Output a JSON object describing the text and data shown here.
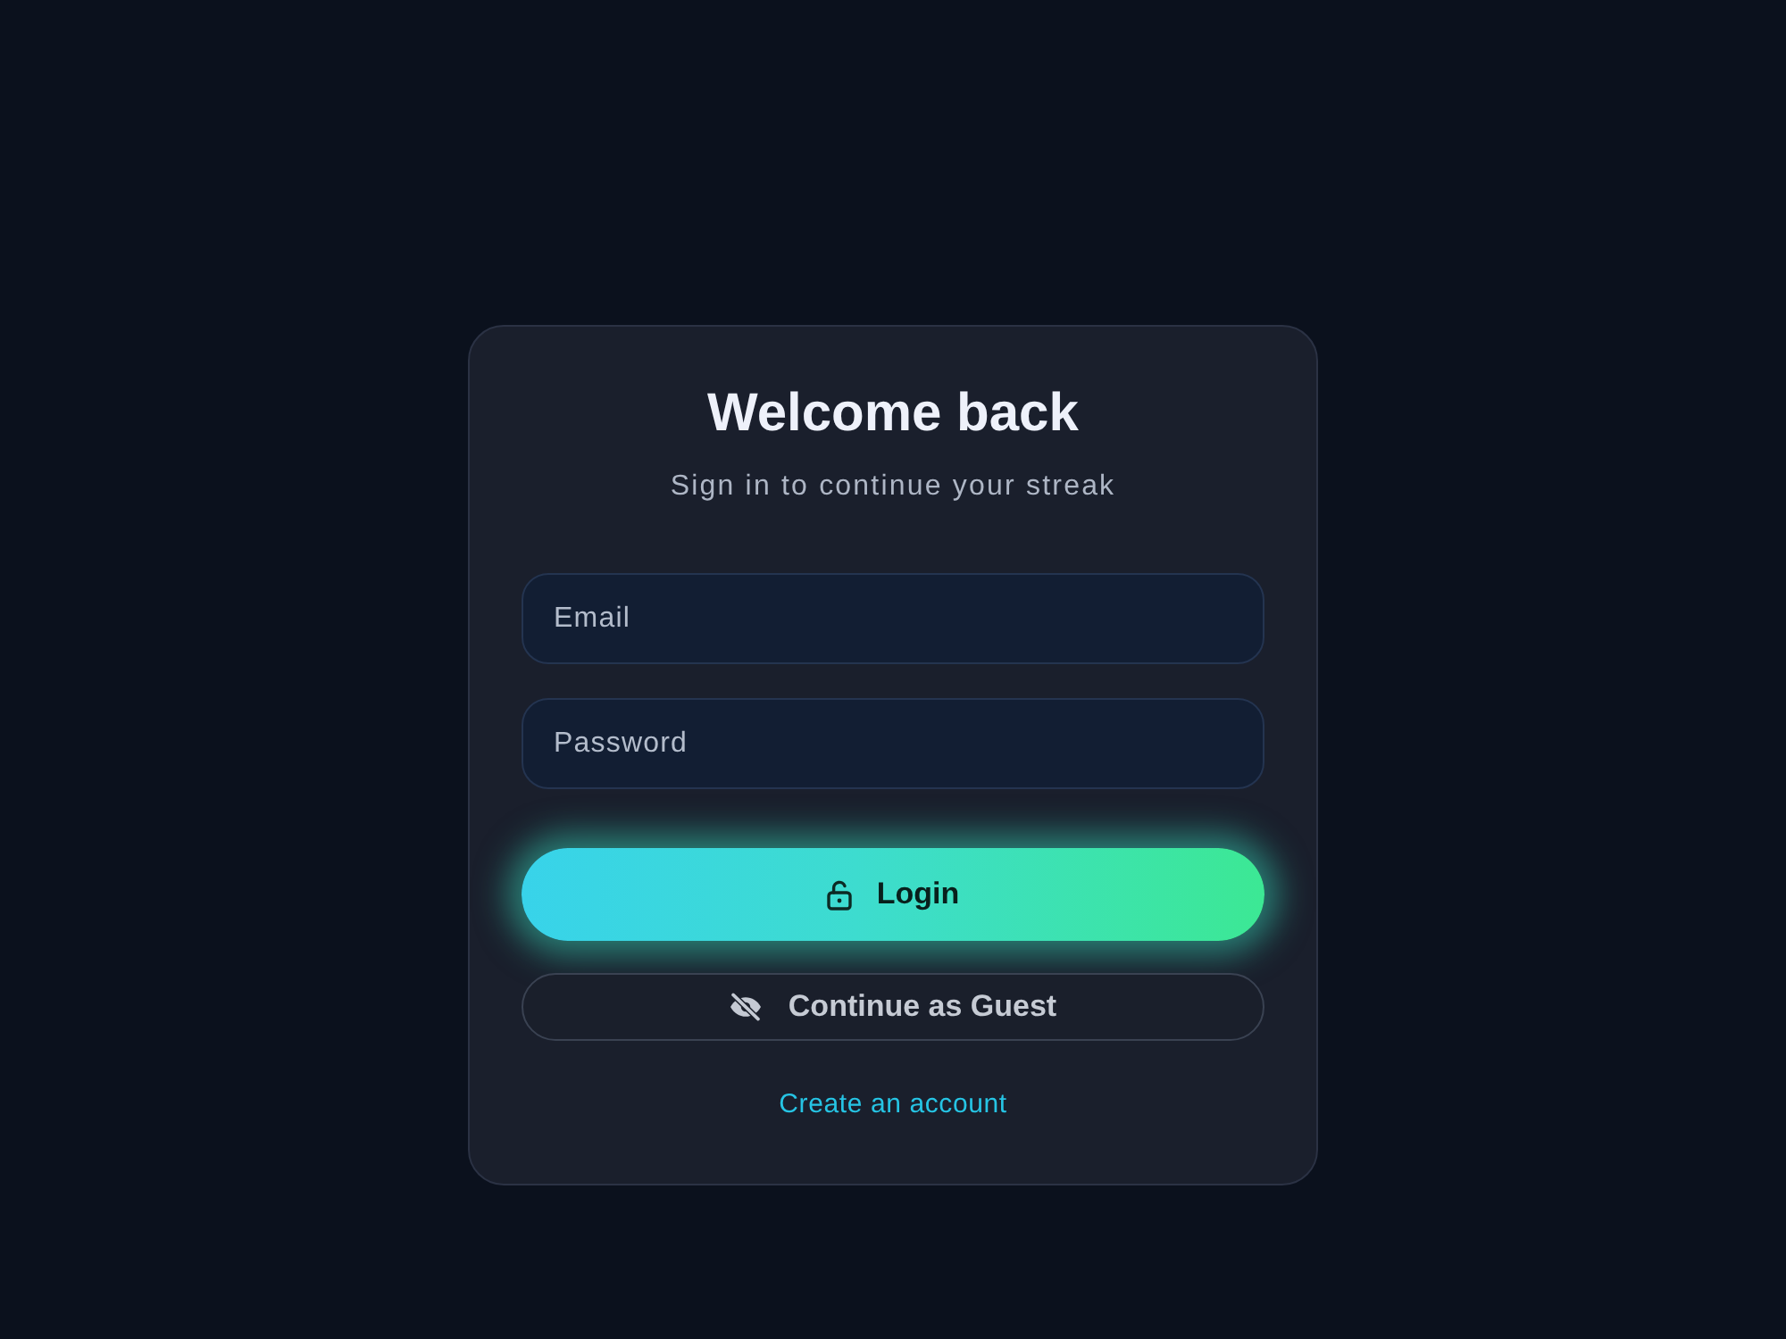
{
  "card": {
    "title": "Welcome back",
    "subtitle": "Sign in to continue your streak"
  },
  "fields": [
    {
      "placeholder": "Email"
    },
    {
      "placeholder": "Password"
    }
  ],
  "buttons": [
    {
      "kind": "primary",
      "label": "Login"
    },
    {
      "kind": "secondary",
      "label": "Continue as Guest"
    }
  ],
  "link": "Create an account"
}
